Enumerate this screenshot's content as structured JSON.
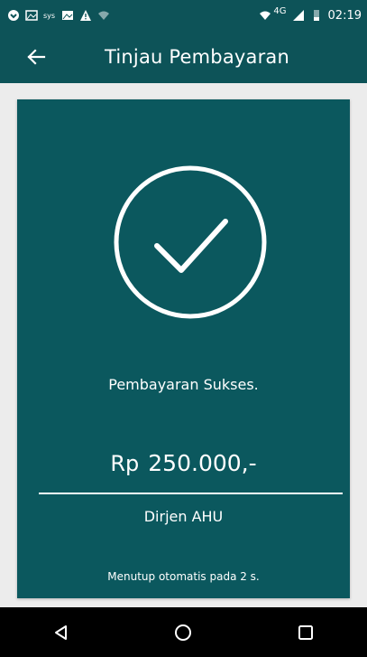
{
  "status_bar": {
    "network": "4G",
    "time": "02:19",
    "icons_left": [
      "vpn-icon",
      "image-icon",
      "phone-signal-icon",
      "gallery-icon",
      "warning-icon",
      "wifi-icon"
    ],
    "icons_right": [
      "wifi-icon",
      "signal-icon",
      "battery-icon"
    ]
  },
  "app_bar": {
    "title": "Tinjau Pembayaran",
    "back_icon": "arrow-left-icon"
  },
  "receipt": {
    "status_icon": "check-circle-icon",
    "status_text": "Pembayaran Sukses.",
    "currency": "Rp",
    "amount": "250.000,-",
    "merchant": "Dirjen AHU",
    "auto_close_text": "Menutup otomatis pada 2 s."
  },
  "nav_bar": {
    "buttons": [
      "back-triangle-icon",
      "home-circle-icon",
      "recents-square-icon"
    ]
  },
  "colors": {
    "primary": "#0d5358",
    "card": "#0b585e",
    "background": "#ececec",
    "text": "#ffffff"
  }
}
